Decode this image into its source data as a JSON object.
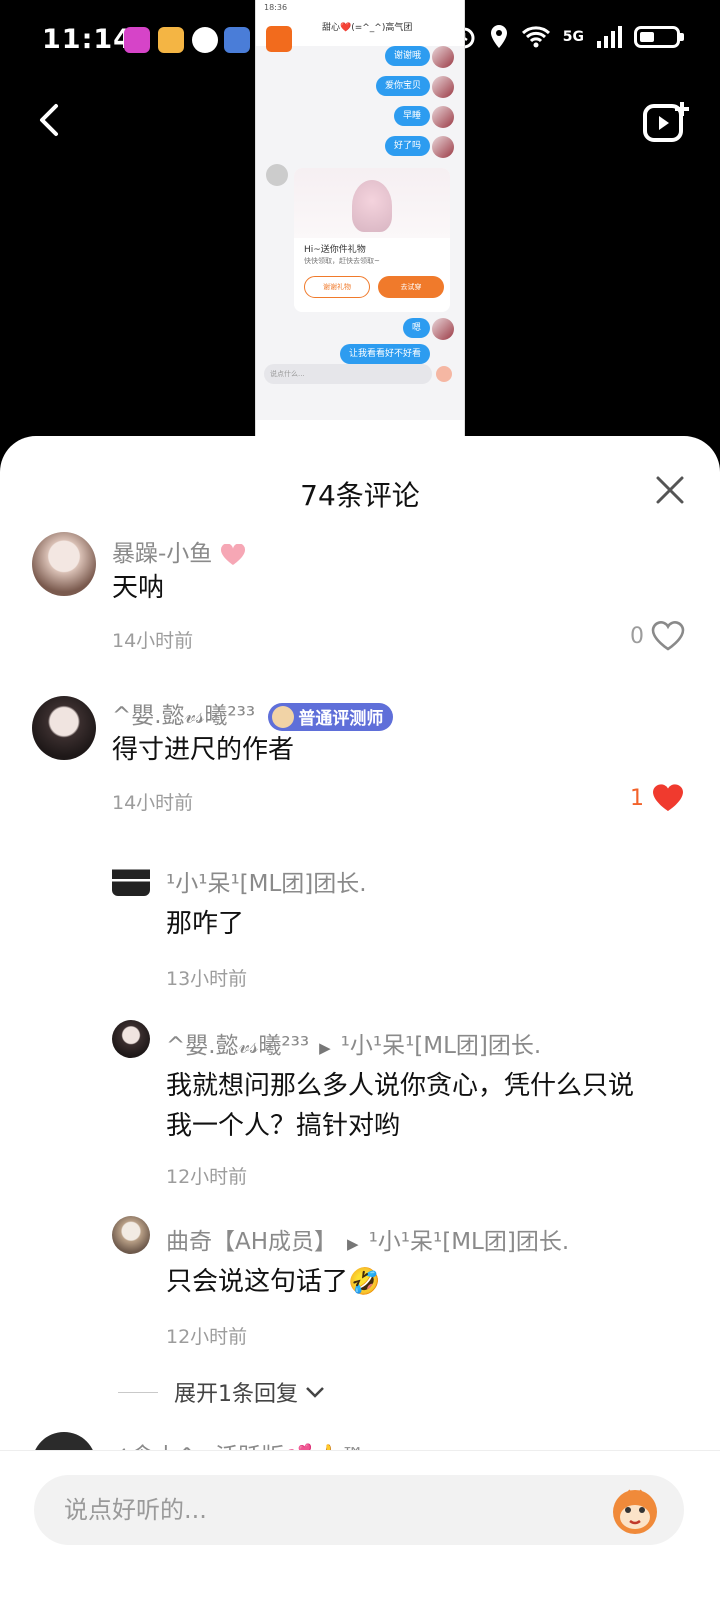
{
  "status_bar": {
    "time": "11:14",
    "network": "5G"
  },
  "preview": {
    "status_time": "18:36",
    "chat_title": "甜心❤️(=^_^)高气团",
    "chat_subtitle": "",
    "bubbles": [
      "谢谢哦",
      "爱你宝贝",
      "早睡",
      "好了吗",
      "嗯",
      "让我看看好不好看"
    ],
    "card_title": "Hi~送你件礼物",
    "card_subtitle": "快快领取，赶快去领取~",
    "card_btn_left": "谢谢礼物",
    "card_btn_right": "去试穿",
    "input_placeholder": "说点什么..."
  },
  "sheet": {
    "title": "74条评论"
  },
  "comments": [
    {
      "name": "暴躁-小鱼",
      "text": "天呐",
      "time": "14小时前",
      "likes": "0",
      "liked": false
    },
    {
      "name": "^嬰.懿𝓋𝓈曦²³³",
      "badge": "普通评测师",
      "text": "得寸进尺的作者",
      "time": "14小时前",
      "likes": "1",
      "liked": true
    }
  ],
  "replies": [
    {
      "name": "¹小¹呆¹[ML团]团长.",
      "text": "那咋了",
      "time": "13小时前"
    },
    {
      "name": "^嬰.懿𝓋𝓈曦²³³",
      "reply_to": "¹小¹呆¹[ML团]团长.",
      "text_line1": "我就想问那么多人说你贪心，凭什么只说",
      "text_line2": "我一个人？搞针对哟",
      "time": "12小时前"
    },
    {
      "name": "曲奇【AH成员】",
      "reply_to": "¹小¹呆¹[ML团]团长.",
      "text": "只会说这句话了🤣",
      "time": "12小时前"
    }
  ],
  "expand_label": "展开1条回复",
  "partial_next_name": "✍念小^ꪆ活跃版💕👍™",
  "input_placeholder": "说点好听的...",
  "colors": {
    "accent": "#f2622a",
    "badge": "#5f6fd9",
    "heart_liked": "#f03a2e"
  }
}
